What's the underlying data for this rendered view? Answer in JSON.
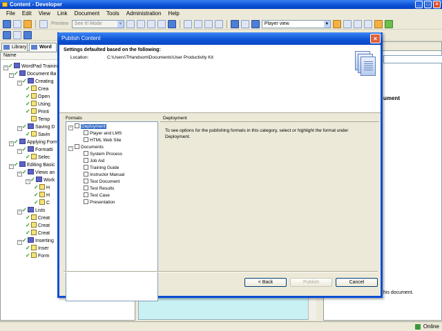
{
  "window": {
    "title": "Content - Developer"
  },
  "menu": [
    "File",
    "Edit",
    "View",
    "Link",
    "Document",
    "Tools",
    "Administration",
    "Help"
  ],
  "toolbar": {
    "preview_label": "Preview",
    "mode_value": "See It! Mode",
    "view_value": "Player view"
  },
  "library": {
    "tabs": [
      "Library",
      "Word"
    ],
    "column_header": "Name",
    "tree": [
      {
        "label": "WordPad Training",
        "kind": "book",
        "check": true
      },
      {
        "label": "Document Ba",
        "kind": "book",
        "check": true
      },
      {
        "label": "Creating",
        "kind": "book",
        "check": true
      },
      {
        "label": "Crea",
        "kind": "topic",
        "check": true
      },
      {
        "label": "Open",
        "kind": "topic",
        "check": true
      },
      {
        "label": "Using",
        "kind": "topic",
        "check": true
      },
      {
        "label": "Printi",
        "kind": "topic",
        "check": true
      },
      {
        "label": "Temp",
        "kind": "topic",
        "check": false
      },
      {
        "label": "Saving D",
        "kind": "book",
        "check": true
      },
      {
        "label": "Savin",
        "kind": "topic",
        "check": true
      },
      {
        "label": "Applying Form",
        "kind": "book",
        "check": true
      },
      {
        "label": "Formatti",
        "kind": "book",
        "check": true
      },
      {
        "label": "Selec",
        "kind": "topic",
        "check": true
      },
      {
        "label": "Editing Basic",
        "kind": "book",
        "check": true
      },
      {
        "label": "Views an",
        "kind": "book",
        "check": true
      },
      {
        "label": "Work",
        "kind": "book",
        "check": true
      },
      {
        "label": "H",
        "kind": "topic",
        "check": true
      },
      {
        "label": "H",
        "kind": "topic",
        "check": true
      },
      {
        "label": "C",
        "kind": "topic",
        "check": true
      },
      {
        "label": "Lists",
        "kind": "book",
        "check": true
      },
      {
        "label": "Creat",
        "kind": "topic",
        "check": true
      },
      {
        "label": "Creat",
        "kind": "topic",
        "check": true
      },
      {
        "label": "Creat",
        "kind": "topic",
        "check": true
      },
      {
        "label": "Inserting",
        "kind": "book",
        "check": true
      },
      {
        "label": "Inser",
        "kind": "topic",
        "check": true
      },
      {
        "label": "Form",
        "kind": "topic",
        "check": true
      }
    ]
  },
  "right_pane": {
    "heading": "ument",
    "footer_text": "his document."
  },
  "status": {
    "online": "Online"
  },
  "dialog": {
    "title": "Publish Content",
    "heading": "Settings defaulted based on the following:",
    "location_label": "Location:",
    "location_value": "C:\\Users\\THandsom\\Documents\\User Productivity Kit",
    "formats_label": "Formats",
    "formats": [
      {
        "label": "Deployment",
        "level": 0,
        "expander": "−",
        "selected": true
      },
      {
        "label": "Player and LMS",
        "level": 1
      },
      {
        "label": "HTML Web Site",
        "level": 1
      },
      {
        "label": "Documents",
        "level": 0,
        "expander": "−"
      },
      {
        "label": "System Process",
        "level": 1
      },
      {
        "label": "Job Aid",
        "level": 1
      },
      {
        "label": "Training Guide",
        "level": 1
      },
      {
        "label": "Instructor Manual",
        "level": 1
      },
      {
        "label": "Test Document",
        "level": 1
      },
      {
        "label": "Test Results",
        "level": 1
      },
      {
        "label": "Test Case",
        "level": 1
      },
      {
        "label": "Presentation",
        "level": 1
      }
    ],
    "detail_label": "Deployment",
    "detail_text": "To see options for the publishing formats in this category, select or highlight the format under Deployment.",
    "buttons": {
      "back": "< Back",
      "publish": "Publish",
      "cancel": "Cancel"
    }
  }
}
